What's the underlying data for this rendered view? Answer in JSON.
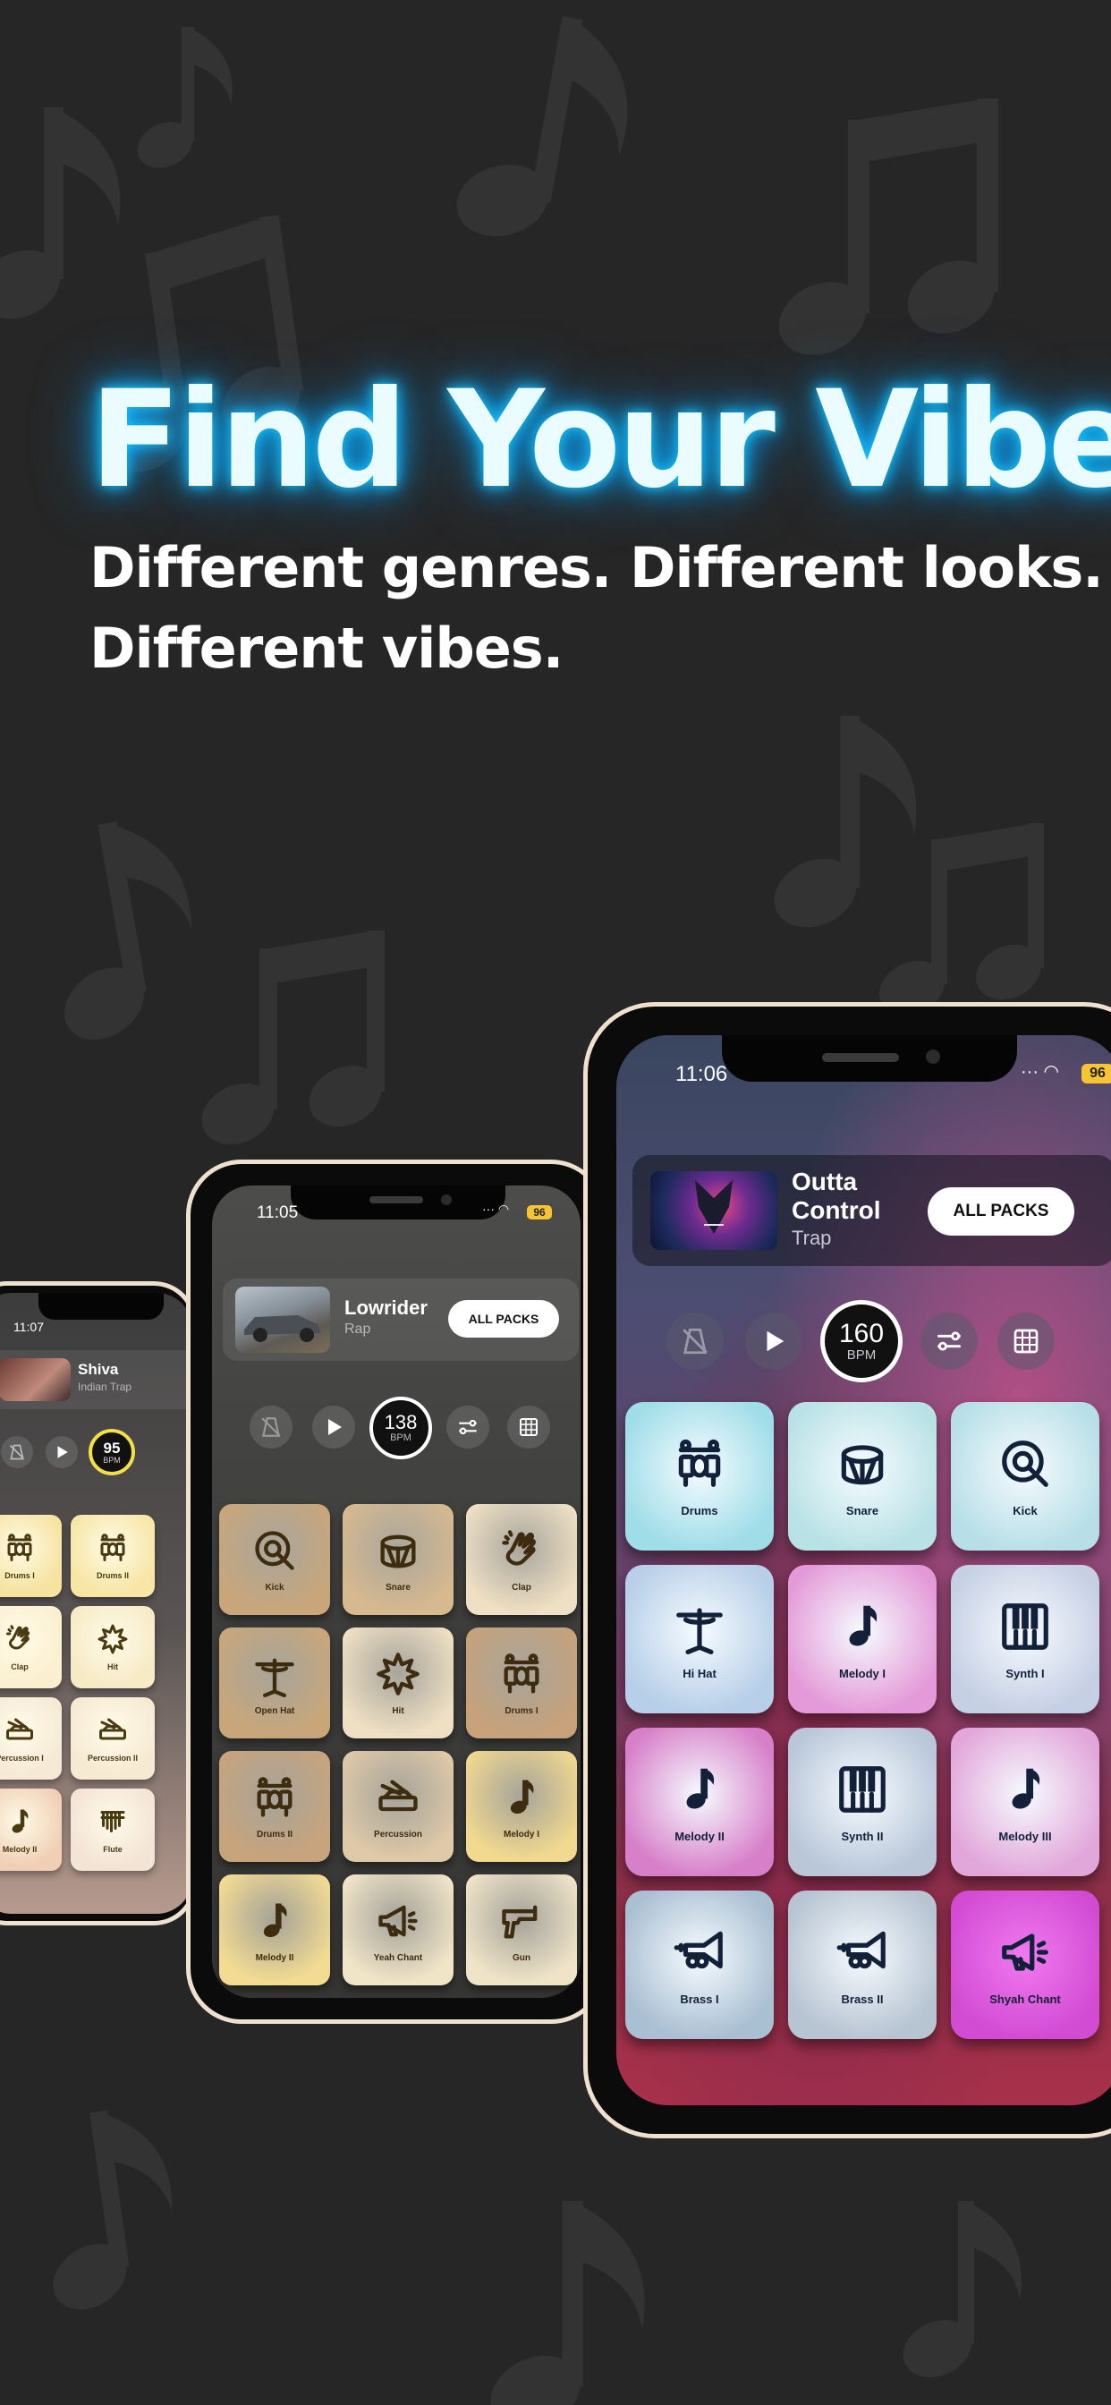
{
  "headline": "Find Your Vibe",
  "subline1": "Different genres. Different looks.",
  "subline2": "Different vibes.",
  "colors": {
    "background": "#262626",
    "glow": "#18c8ff",
    "phone_frame": "#efe1ce",
    "battery": "#f6c531"
  },
  "phones": {
    "left": {
      "time": "11:07",
      "pack_name": "Shiva",
      "pack_genre": "Indian Trap",
      "bpm": "95",
      "bpm_unit": "BPM",
      "pads": [
        {
          "label": "Drums I",
          "icon": "drum-kit-icon"
        },
        {
          "label": "Drums II",
          "icon": "drum-kit-icon"
        },
        {
          "label": "Clap",
          "icon": "clap-icon"
        },
        {
          "label": "Hit",
          "icon": "burst-icon"
        },
        {
          "label": "Percussion I",
          "icon": "percussion-icon"
        },
        {
          "label": "Percussion II",
          "icon": "percussion-icon"
        },
        {
          "label": "Melody II",
          "icon": "music-note-icon"
        },
        {
          "label": "Flute",
          "icon": "pan-flute-icon"
        }
      ]
    },
    "middle": {
      "time": "11:05",
      "battery": "96",
      "pack_name": "Lowrider",
      "pack_genre": "Rap",
      "all_packs": "ALL PACKS",
      "bpm": "138",
      "bpm_unit": "BPM",
      "pads": [
        {
          "label": "Kick",
          "icon": "kick-icon"
        },
        {
          "label": "Snare",
          "icon": "snare-drum-icon"
        },
        {
          "label": "Clap",
          "icon": "clap-icon"
        },
        {
          "label": "Open Hat",
          "icon": "hi-hat-icon"
        },
        {
          "label": "Hit",
          "icon": "burst-icon"
        },
        {
          "label": "Drums I",
          "icon": "drum-kit-icon"
        },
        {
          "label": "Drums II",
          "icon": "drum-kit-icon"
        },
        {
          "label": "Percussion",
          "icon": "percussion-icon"
        },
        {
          "label": "Melody I",
          "icon": "music-note-icon"
        },
        {
          "label": "Melody II",
          "icon": "music-note-icon"
        },
        {
          "label": "Yeah Chant",
          "icon": "megaphone-icon"
        },
        {
          "label": "Gun",
          "icon": "gun-icon"
        }
      ]
    },
    "right": {
      "time": "11:06",
      "battery": "96",
      "pack_name_line1": "Outta",
      "pack_name_line2": "Control",
      "pack_genre": "Trap",
      "all_packs": "ALL PACKS",
      "bpm": "160",
      "bpm_unit": "BPM",
      "pads": [
        {
          "label": "Drums",
          "icon": "drum-kit-icon"
        },
        {
          "label": "Snare",
          "icon": "snare-drum-icon"
        },
        {
          "label": "Kick",
          "icon": "kick-icon"
        },
        {
          "label": "Hi Hat",
          "icon": "hi-hat-icon"
        },
        {
          "label": "Melody I",
          "icon": "music-note-icon"
        },
        {
          "label": "Synth I",
          "icon": "piano-keys-icon"
        },
        {
          "label": "Melody II",
          "icon": "music-note-icon"
        },
        {
          "label": "Synth II",
          "icon": "piano-keys-icon"
        },
        {
          "label": "Melody III",
          "icon": "music-note-icon"
        },
        {
          "label": "Brass I",
          "icon": "trumpet-icon"
        },
        {
          "label": "Brass II",
          "icon": "trumpet-icon"
        },
        {
          "label": "Shyah Chant",
          "icon": "megaphone-icon"
        }
      ]
    }
  }
}
